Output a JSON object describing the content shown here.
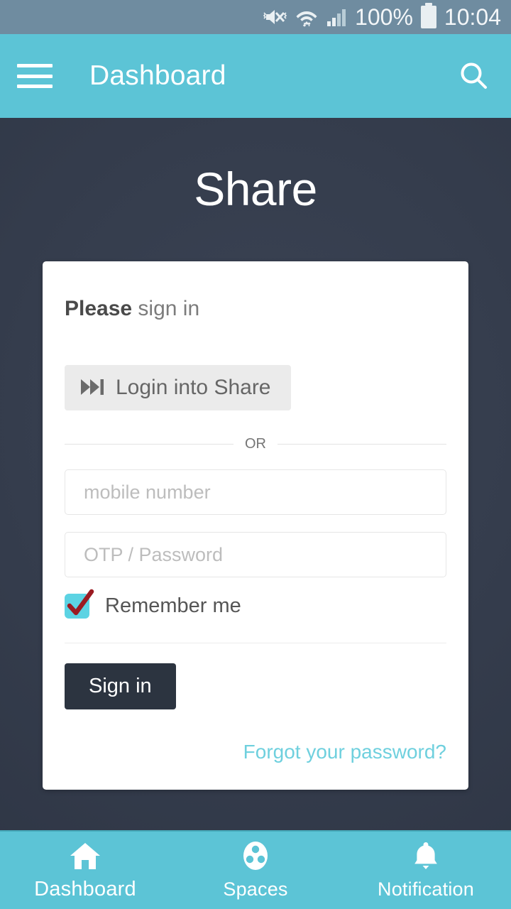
{
  "status_bar": {
    "mute_icon": "vibrate-mute-icon",
    "wifi_icon": "wifi-icon",
    "signal_icon": "cellular-signal-icon",
    "battery_percent": "100%",
    "battery_icon": "battery-full-icon",
    "time": "10:04",
    "background": "#6f8ca0"
  },
  "app_bar": {
    "menu_icon": "hamburger-menu-icon",
    "title": "Dashboard",
    "search_icon": "search-icon",
    "background": "#5cc4d6"
  },
  "main": {
    "page_title": "Share",
    "background": "#353d4d"
  },
  "card": {
    "heading_bold": "Please",
    "heading_rest": " sign in",
    "sso_button": {
      "icon": "skip-forward-icon",
      "label": "Login into Share"
    },
    "divider_label": "OR",
    "fields": [
      {
        "name": "mobile-number",
        "placeholder": "mobile number",
        "value": ""
      },
      {
        "name": "otp-password",
        "placeholder": "OTP / Password",
        "value": ""
      }
    ],
    "remember": {
      "label": "Remember me",
      "checked": true,
      "box_color": "#5cd3e3",
      "tick_color": "#9b1b22"
    },
    "submit_label": "Sign in",
    "submit_color": "#2c3440",
    "forgot_label": "Forgot your password?",
    "forgot_color": "#6fd0de"
  },
  "bottom_nav": {
    "items": [
      {
        "label": "Dashboard",
        "icon": "home-icon",
        "active": true
      },
      {
        "label": "Spaces",
        "icon": "spaces-icon",
        "active": false
      },
      {
        "label": "Notification",
        "icon": "bell-icon",
        "active": false
      }
    ],
    "background": "#5cc4d6"
  }
}
